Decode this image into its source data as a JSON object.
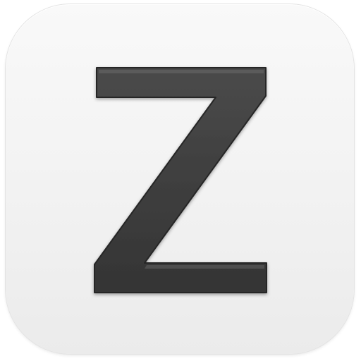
{
  "app_icon": {
    "icon_name": "letter-z-icon",
    "colors": {
      "tile_top": "#f9f9f9",
      "tile_bottom": "#ebebeb",
      "glyph_fill": "#3d3d3d",
      "glyph_highlight": "#6a6a6a",
      "glyph_outline": "#262626"
    }
  }
}
